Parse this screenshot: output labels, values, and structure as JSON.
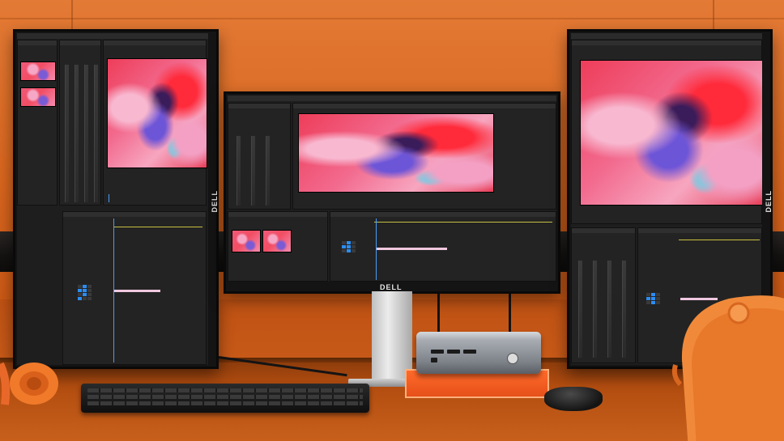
{
  "brand": {
    "left_monitor": "DELL",
    "center_monitor": "DELL",
    "right_monitor": "DELL"
  },
  "colors": {
    "wall": "#d8661f",
    "desk": "#b24d10",
    "editor_dark": "#1e1e1e",
    "accent_blue": "#2d8cf0",
    "artwork_pink": "#f26a8e",
    "artwork_purple": "#6d55d8",
    "riser_orange": "#ff6a2a"
  },
  "icons": {
    "headphones": "headphones-icon",
    "mouse": "mouse-icon",
    "chair": "chair-icon"
  }
}
